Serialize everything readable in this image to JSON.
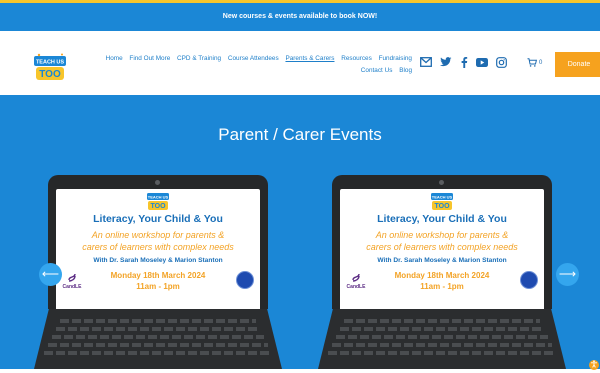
{
  "announcement": "New courses & events available to book NOW!",
  "brand": {
    "logo_text_top": "TEACH US",
    "logo_text_bottom": "TOO",
    "colors": {
      "blue": "#1b87d6",
      "orange": "#f6a21e",
      "yellow": "#f7c52b",
      "navy": "#1a6fb8"
    }
  },
  "nav": {
    "row1": [
      "Home",
      "Find Out More",
      "CPD & Training",
      "Course Attendees",
      "Parents & Carers",
      "Resources",
      "Fundraising"
    ],
    "row2": [
      "Contact Us",
      "Blog"
    ],
    "active": "Parents & Carers"
  },
  "socials": [
    "mail-icon",
    "twitter-icon",
    "facebook-icon",
    "youtube-icon",
    "instagram-icon"
  ],
  "cart": {
    "count": "0"
  },
  "donate_label": "Donate",
  "hero": {
    "title": "Parent / Carer Events",
    "prev_arrow": "⟵",
    "next_arrow": "⟶"
  },
  "slides": [
    {
      "title": "Literacy, Your Child & You",
      "subtitle_line1": "An online workshop for parents &",
      "subtitle_line2": "carers of learners with complex needs",
      "with": "With Dr. Sarah Moseley & Marion Stanton",
      "date": "Monday 18th March 2024",
      "time": "11am - 1pm",
      "partner": "CandLE"
    },
    {
      "title": "Literacy, Your Child & You",
      "subtitle_line1": "An online workshop for parents &",
      "subtitle_line2": "carers of learners with complex needs",
      "with": "With Dr. Sarah Moseley & Marion Stanton",
      "date": "Monday 18th March 2024",
      "time": "11am - 1pm",
      "partner": "CandLE"
    }
  ],
  "accessibility_icon": "accessibility-icon"
}
